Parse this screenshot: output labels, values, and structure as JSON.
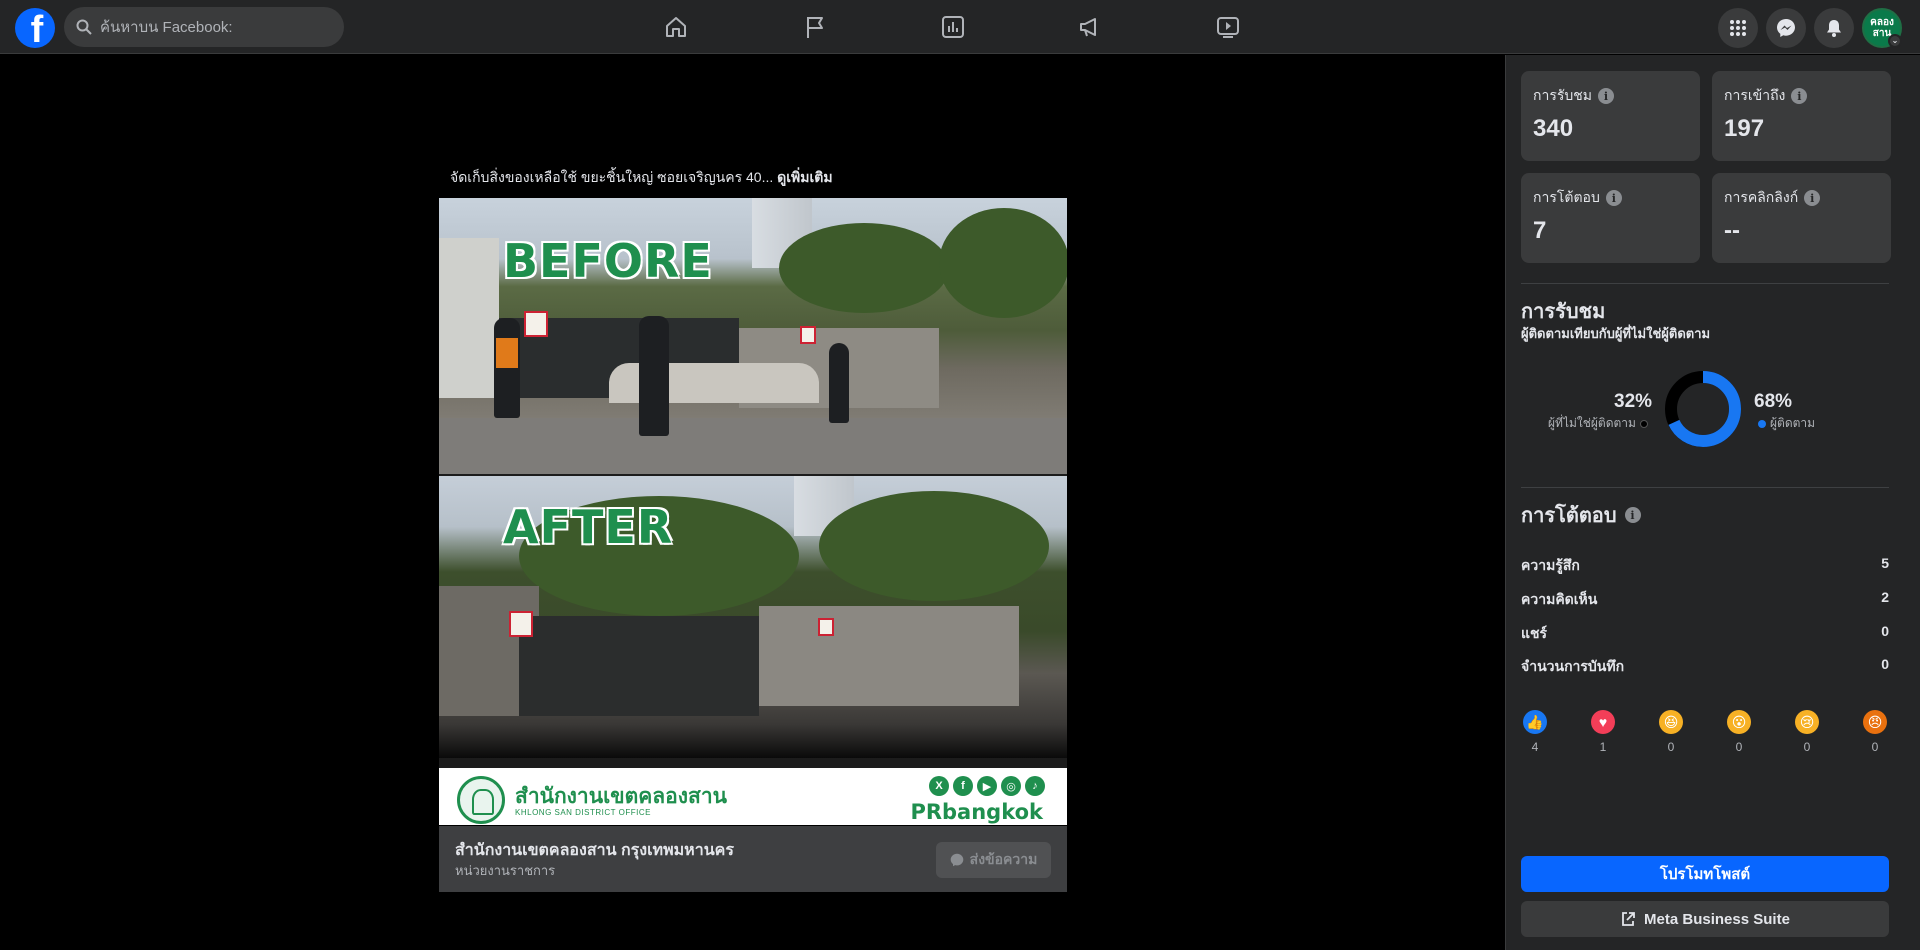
{
  "topbar": {
    "logo_letter": "f",
    "search_placeholder": "ค้นหาบน Facebook:",
    "avatar_text": "คลอง สาน"
  },
  "post": {
    "caption": "จัดเก็บสิ่งของเหลือใช้ ขยะชิ้นใหญ่ ซอยเจริญนคร 40...",
    "see_more": "ดูเพิ่มเติม",
    "image_label_before": "BEFORE",
    "image_label_after": "AFTER",
    "office_th": "สำนักงานเขตคลองสาน",
    "office_en": "KHLONG SAN DISTRICT OFFICE",
    "brand_handle": "PRbangkok",
    "page_name": "สำนักงานเขตคลองสาน กรุงเทพมหานคร",
    "page_category": "หน่วยงานราชการ",
    "send_message_label": "ส่งข้อความ"
  },
  "insights": {
    "views_label": "การรับชม",
    "views_value": "340",
    "reach_label": "การเข้าถึง",
    "reach_value": "197",
    "engagement_label": "การโต้ตอบ",
    "engagement_value": "7",
    "link_clicks_label": "การคลิกลิงก์",
    "link_clicks_value": "--"
  },
  "views_section": {
    "title": "การรับชม",
    "subtitle": "ผู้ติดตามเทียบกับผู้ที่ไม่ใช่ผู้ติดตาม",
    "non_follower_pct": "32%",
    "non_follower_label": "ผู้ที่ไม่ใช่ผู้ติดตาม",
    "follower_pct": "68%",
    "follower_label": "ผู้ติดตาม",
    "follower_share": 0.68,
    "colors": {
      "follower": "#1877f2",
      "non_follower": "#000000"
    }
  },
  "engagement_section": {
    "title": "การโต้ตอบ",
    "rows": [
      {
        "label": "ความรู้สึก",
        "value": "5"
      },
      {
        "label": "ความคิดเห็น",
        "value": "2"
      },
      {
        "label": "แชร์",
        "value": "0"
      },
      {
        "label": "จำนวนการบันทึก",
        "value": "0"
      }
    ],
    "reactions": [
      {
        "icon": "like-icon",
        "count": "4",
        "color": "#1877f2"
      },
      {
        "icon": "love-icon",
        "count": "1",
        "color": "#f33e58"
      },
      {
        "icon": "haha-icon",
        "count": "0",
        "color": "#f7b125"
      },
      {
        "icon": "wow-icon",
        "count": "0",
        "color": "#f7b125"
      },
      {
        "icon": "sad-icon",
        "count": "0",
        "color": "#f7b125"
      },
      {
        "icon": "angry-icon",
        "count": "0",
        "color": "#e9710f"
      }
    ]
  },
  "actions": {
    "promote_label": "โปรโมทโพสต์",
    "business_suite_label": "Meta Business Suite"
  }
}
